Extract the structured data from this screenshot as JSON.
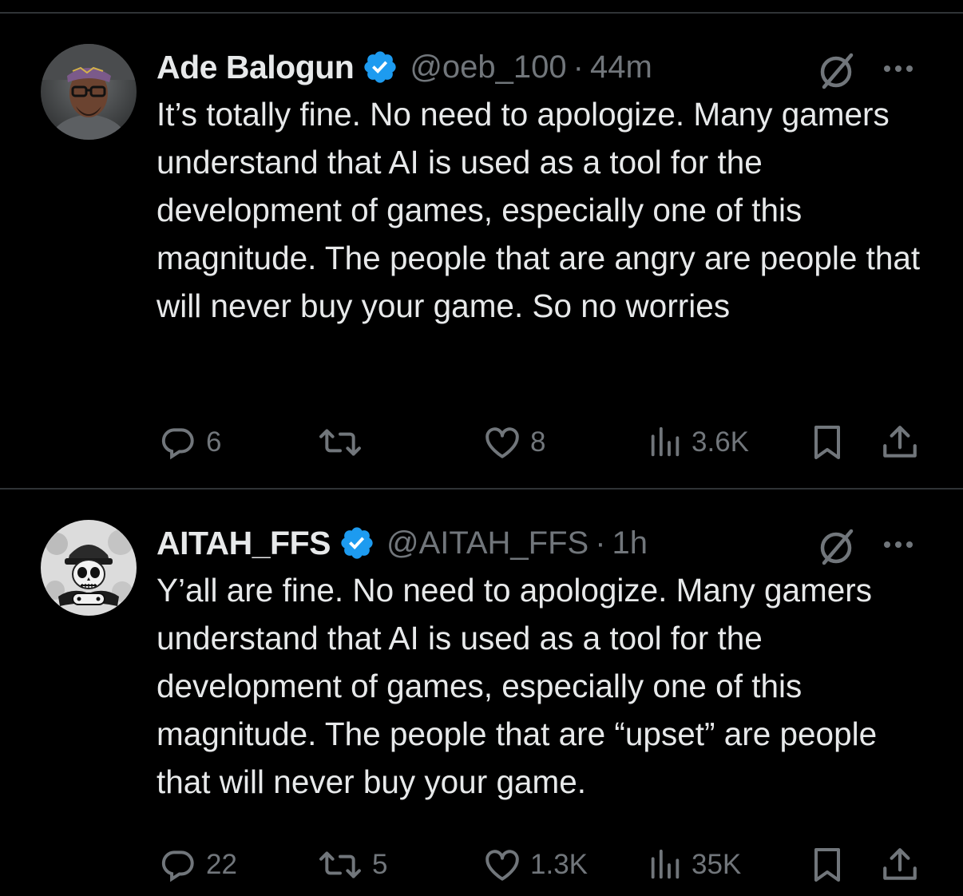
{
  "colors": {
    "background": "#000000",
    "text": "#e7e9ea",
    "muted": "#71767b",
    "divider": "#2f3336",
    "verified_badge": "#1d9bf0"
  },
  "tweets": [
    {
      "display_name": "Ade Balogun",
      "verified": true,
      "handle": "@oeb_100",
      "separator": "·",
      "time": "44m",
      "text": "It’s totally fine. No need to apologize. Many gamers understand that AI is used as a tool for the development of games, especially one of this magnitude. The people that are angry are people that will never buy your game. So no worries",
      "replies": "6",
      "reposts": "",
      "likes": "8",
      "views": "3.6K",
      "icons": [
        "reply-icon",
        "repost-icon",
        "like-icon",
        "views-icon",
        "bookmark-icon",
        "share-icon"
      ]
    },
    {
      "display_name": "AITAH_FFS",
      "verified": true,
      "handle": "@AITAH_FFS",
      "separator": "·",
      "time": "1h",
      "text": "Y’all are fine. No need to apologize. Many gamers understand that AI is used as a tool for the development of games, especially one of this magnitude. The people that are “upset” are people that will never buy your game.",
      "replies": "22",
      "reposts": "5",
      "likes": "1.3K",
      "views": "35K",
      "icons": [
        "reply-icon",
        "repost-icon",
        "like-icon",
        "views-icon",
        "bookmark-icon",
        "share-icon"
      ]
    }
  ]
}
